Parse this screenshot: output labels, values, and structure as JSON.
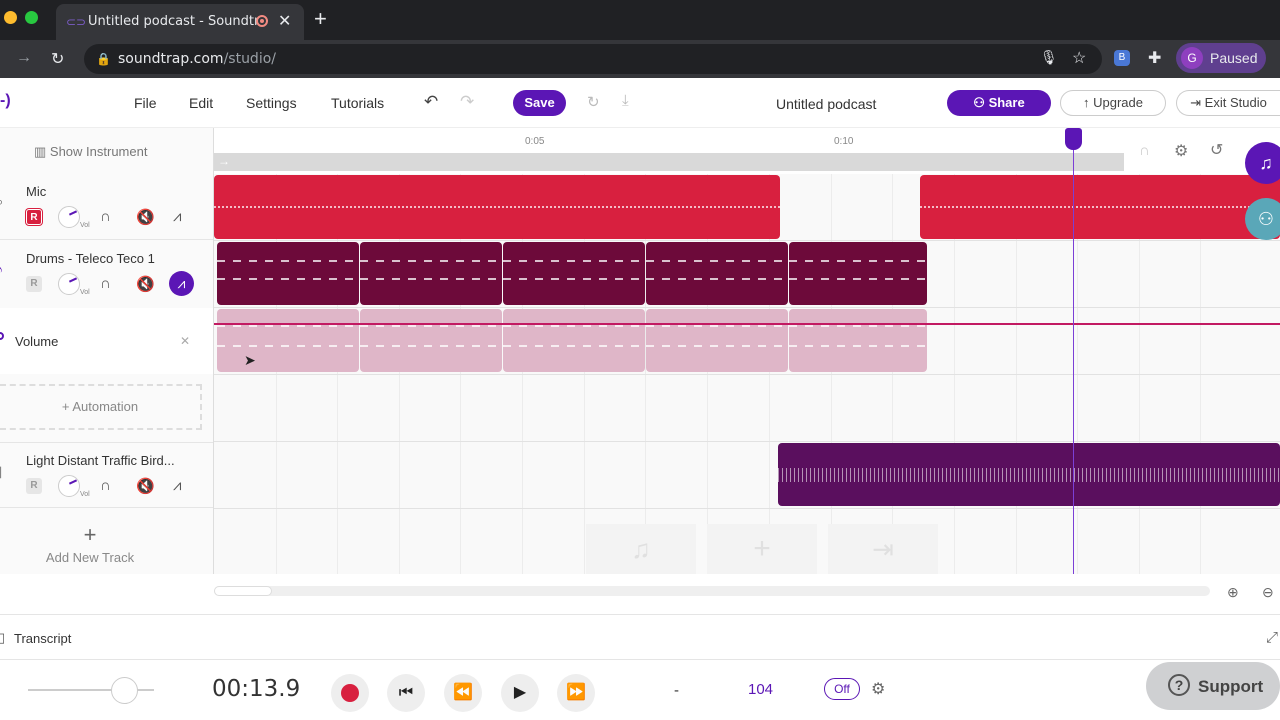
{
  "browser": {
    "tab_title": "Untitled podcast - Soundtrap",
    "tab_close": "✕",
    "new_tab": "+",
    "url_host": "soundtrap.com",
    "url_path": "/studio/",
    "profile_initial": "G",
    "profile_status": "Paused",
    "ext_badge": "B"
  },
  "menubar": {
    "file": "File",
    "edit": "Edit",
    "settings": "Settings",
    "tutorials": "Tutorials",
    "save": "Save",
    "project_title": "Untitled podcast",
    "share": "Share",
    "upgrade": "Upgrade",
    "exit": "Exit Studio"
  },
  "sidebar": {
    "show_instrument": "Show Instrument",
    "add_automation": "+ Automation",
    "add_track": "Add New Track",
    "add_track_icon": "+"
  },
  "tracks": [
    {
      "name": "Mic",
      "record_label": "R",
      "vol_label": "Vol",
      "armed": true
    },
    {
      "name": "Drums - Teleco Teco 1",
      "record_label": "R",
      "vol_label": "Vol",
      "armed": false
    },
    {
      "name": "Light Distant Traffic Bird...",
      "record_label": "R",
      "vol_label": "Vol",
      "armed": false
    }
  ],
  "automation": {
    "label": "Volume",
    "close": "✕"
  },
  "ruler": {
    "tick1": "0:05",
    "tick2": "0:10"
  },
  "colors": {
    "mic_clip": "#d8203f",
    "drums_clip": "#6d0a3a",
    "drums_auto_clip": "#dfb6c8",
    "traffic_clip": "#5a0f5e",
    "accent": "#5b16b5"
  },
  "transcript": {
    "label": "Transcript"
  },
  "transport": {
    "time": "00:13.9",
    "key": "-",
    "tempo": "104",
    "metronome": "Off"
  },
  "support": {
    "label": "Support",
    "icon": "?"
  }
}
